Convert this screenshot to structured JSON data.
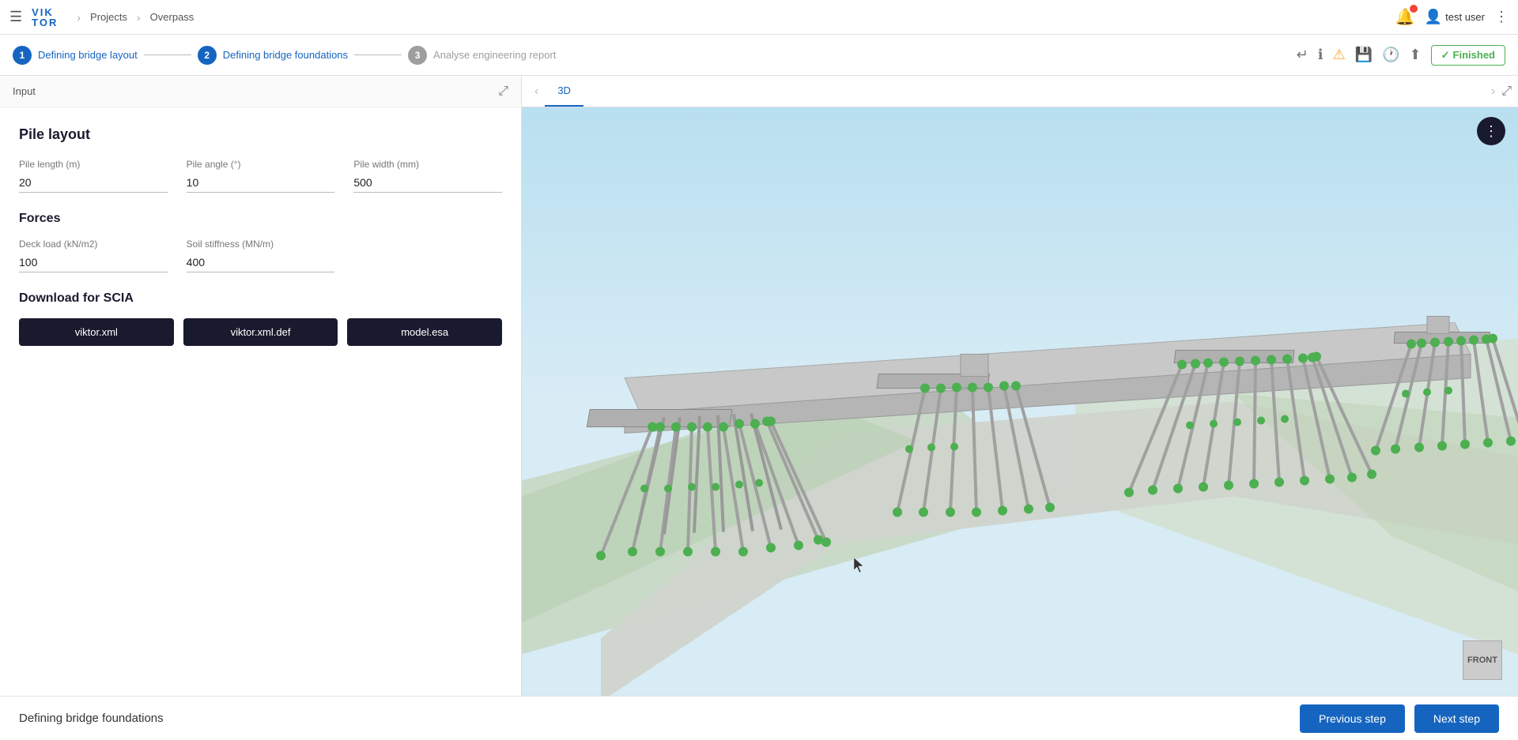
{
  "topbar": {
    "hamburger_label": "☰",
    "logo_vik": "VIK",
    "logo_tor": "TOR",
    "nav_projects": "Projects",
    "nav_overpass": "Overpass",
    "nav_arrow": "›",
    "user_name": "test user",
    "user_icon": "👤",
    "more_icon": "⋮"
  },
  "stepper": {
    "step1_number": "1",
    "step1_label": "Defining bridge layout",
    "step2_number": "2",
    "step2_label": "Defining bridge foundations",
    "step3_number": "3",
    "step3_label": "Analyse engineering report",
    "finished_label": "Finished",
    "check_icon": "✓",
    "icons": {
      "return": "↵",
      "info": "ℹ",
      "warning": "⚠",
      "save": "💾",
      "history": "🕐",
      "upload": "⬆"
    }
  },
  "left_panel": {
    "header_label": "Input",
    "expand_icon": "⤢",
    "section": {
      "pile_layout_title": "Pile layout",
      "pile_length_label": "Pile length (m)",
      "pile_length_value": "20",
      "pile_angle_label": "Pile angle (°)",
      "pile_angle_value": "10",
      "pile_width_label": "Pile width (mm)",
      "pile_width_value": "500",
      "forces_title": "Forces",
      "deck_load_label": "Deck load (kN/m2)",
      "deck_load_value": "100",
      "soil_stiffness_label": "Soil stiffness (MN/m)",
      "soil_stiffness_value": "400",
      "download_title": "Download for SCIA",
      "btn1_label": "viktor.xml",
      "btn2_label": "viktor.xml.def",
      "btn3_label": "model.esa"
    }
  },
  "right_panel": {
    "tab_label": "3D",
    "tab_prev_icon": "‹",
    "tab_next_icon": "›",
    "expand_icon": "⤢",
    "more_options_icon": "⋮",
    "view_cube_label": "FRONT"
  },
  "footer": {
    "title": "Defining bridge foundations",
    "prev_btn_label": "Previous step",
    "next_btn_label": "Next step"
  }
}
